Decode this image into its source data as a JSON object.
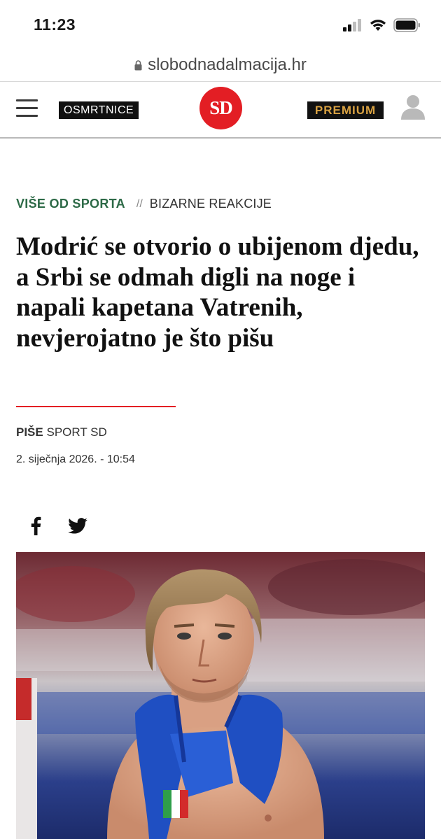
{
  "status_bar": {
    "time": "11:23",
    "icons": [
      "signal-icon",
      "wifi-icon",
      "battery-icon"
    ]
  },
  "url_bar": {
    "url": "slobodnadalmacija.hr",
    "icon": "lock-icon"
  },
  "header": {
    "menu_icon": "hamburger-icon",
    "obituaries_label": "OSMRTNICE",
    "logo_text": "SD",
    "premium_label": "PREMIUM",
    "user_icon": "user-icon",
    "colors": {
      "logo_red": "#e31e24",
      "premium_gold": "#d8a142",
      "badge_black": "#111111"
    }
  },
  "article": {
    "section": "VIŠE OD SPORTA",
    "separator": "//",
    "topic": "BIZARNE REAKCIJE",
    "headline": "Modrić se otvorio o ubijenom djedu, a Srbi se odmah digli na noge i napali kapetana Vatrenih, nevjerojatno je što pišu",
    "byline_label": "PIŠE",
    "author": "SPORT SD",
    "date": "2. siječnja 2026. - 10:54",
    "share_icons": [
      "facebook-icon",
      "twitter-icon"
    ],
    "colors": {
      "section_green": "#2d6a47",
      "accent_red": "#e31e24"
    }
  },
  "hero_image": {
    "description_icon": "article-photo"
  }
}
